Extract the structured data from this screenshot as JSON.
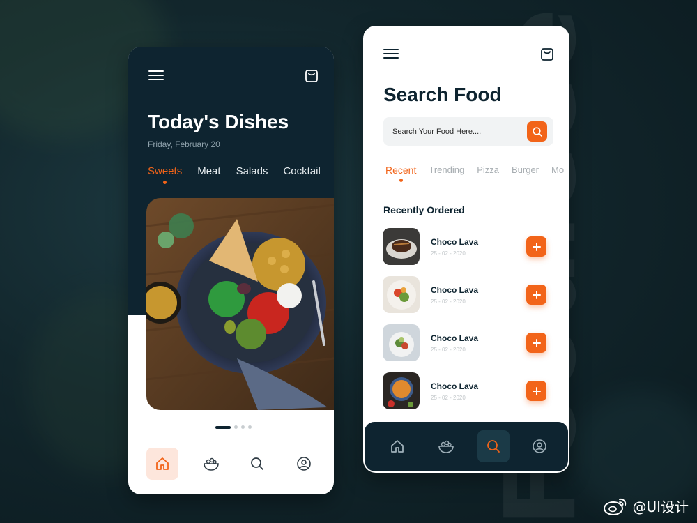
{
  "brand": {
    "word": "Foodieee",
    "watermark": "@UI设计"
  },
  "colors": {
    "accent": "#f26419",
    "dark": "#0e2430"
  },
  "left_screen": {
    "menu_icon": "hamburger-icon",
    "cart_icon": "shopping-bag-icon",
    "title": "Today's Dishes",
    "date": "Friday, February 20",
    "categories": [
      {
        "label": "Sweets",
        "active": true
      },
      {
        "label": "Meat",
        "active": false
      },
      {
        "label": "Salads",
        "active": false
      },
      {
        "label": "Cocktail",
        "active": false
      }
    ],
    "pager": {
      "count": 4,
      "active_index": 0
    },
    "nav": [
      {
        "icon": "home-icon",
        "active": true
      },
      {
        "icon": "bowl-icon",
        "active": false
      },
      {
        "icon": "search-icon",
        "active": false
      },
      {
        "icon": "user-icon",
        "active": false
      }
    ]
  },
  "right_screen": {
    "menu_icon": "hamburger-icon",
    "cart_icon": "shopping-bag-icon",
    "title": "Search Food",
    "search": {
      "placeholder": "Search Your Food Here....",
      "value": ""
    },
    "filters": [
      {
        "label": "Recent",
        "active": true
      },
      {
        "label": "Trending",
        "active": false
      },
      {
        "label": "Pizza",
        "active": false
      },
      {
        "label": "Burger",
        "active": false
      },
      {
        "label": "Mo",
        "active": false
      }
    ],
    "section_title": "Recently Ordered",
    "orders": [
      {
        "name": "Choco Lava",
        "date": "25 - 02 - 2020"
      },
      {
        "name": "Choco Lava",
        "date": "25 - 02 - 2020"
      },
      {
        "name": "Choco Lava",
        "date": "25 - 02 - 2020"
      },
      {
        "name": "Choco Lava",
        "date": "25 - 02 - 2020"
      }
    ],
    "nav": [
      {
        "icon": "home-icon",
        "active": false
      },
      {
        "icon": "bowl-icon",
        "active": false
      },
      {
        "icon": "search-icon",
        "active": true
      },
      {
        "icon": "user-icon",
        "active": false
      }
    ]
  }
}
